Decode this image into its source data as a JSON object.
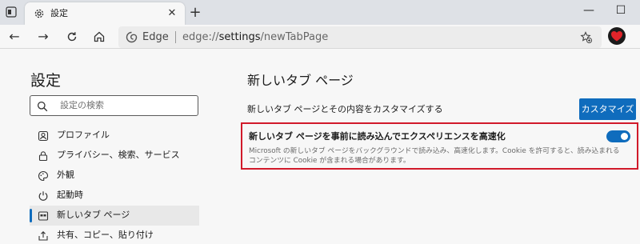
{
  "browser": {
    "tab": {
      "title": "設定",
      "icon": "gear-icon"
    },
    "window_buttons": {
      "minimize": "—",
      "maximize": "☐"
    },
    "address": {
      "site": "Edge",
      "url_prefix": "edge://",
      "url_bold": "settings",
      "url_suffix": "/newTabPage"
    }
  },
  "sidebar": {
    "title": "設定",
    "search_placeholder": "設定の検索",
    "items": [
      {
        "label": "プロファイル",
        "icon": "profile-icon",
        "active": false
      },
      {
        "label": "プライバシー、検索、サービス",
        "icon": "lock-icon",
        "active": false
      },
      {
        "label": "外観",
        "icon": "appearance-icon",
        "active": false
      },
      {
        "label": "起動時",
        "icon": "power-icon",
        "active": false
      },
      {
        "label": "新しいタブ ページ",
        "icon": "new-tab-page-icon",
        "active": true
      },
      {
        "label": "共有、コピー、貼り付け",
        "icon": "share-icon",
        "active": false
      }
    ]
  },
  "main": {
    "title": "新しいタブ ページ",
    "customize_row": {
      "label": "新しいタブ ページとその内容をカスタマイズする",
      "button": "カスタマイズ"
    },
    "preload": {
      "title": "新しいタブ ページを事前に読み込んでエクスペリエンスを高速化",
      "description": "Microsoft の新しいタブ ページをバックグラウンドで読み込み、高速化します。Cookie を許可すると、読み込まれるコンテンツに Cookie が含まれる場合があります。",
      "enabled": true
    }
  },
  "colors": {
    "accent": "#0f6cbd",
    "highlight_border": "#d11a2a"
  }
}
